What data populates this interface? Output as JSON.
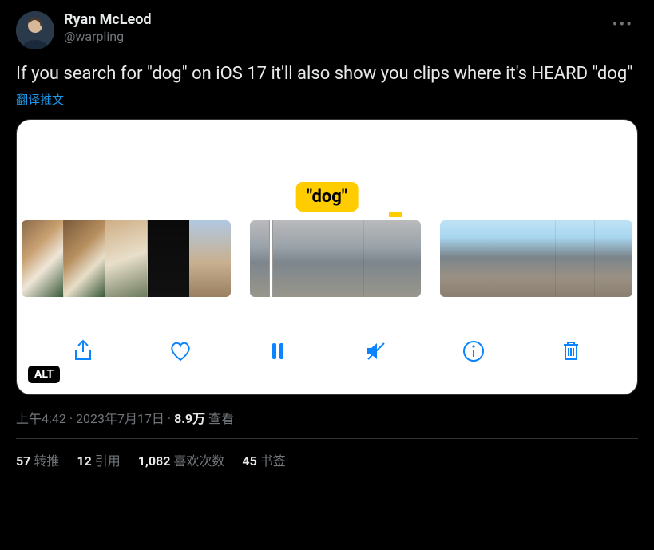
{
  "author": {
    "display_name": "Ryan McLeod",
    "handle": "@warpling"
  },
  "body": "If you search for \"dog\" on iOS 17 it'll also show you clips where it's HEARD \"dog\"",
  "translate_label": "翻译推文",
  "media": {
    "caption_bubble": "\"dog\"",
    "alt_badge": "ALT"
  },
  "meta": {
    "time": "上午4:42",
    "date": "2023年7月17日",
    "views_count": "8.9万",
    "views_label": "查看"
  },
  "stats": {
    "reposts_count": "57",
    "reposts_label": "转推",
    "quotes_count": "12",
    "quotes_label": "引用",
    "likes_count": "1,082",
    "likes_label": "喜欢次数",
    "bookmarks_count": "45",
    "bookmarks_label": "书签"
  }
}
